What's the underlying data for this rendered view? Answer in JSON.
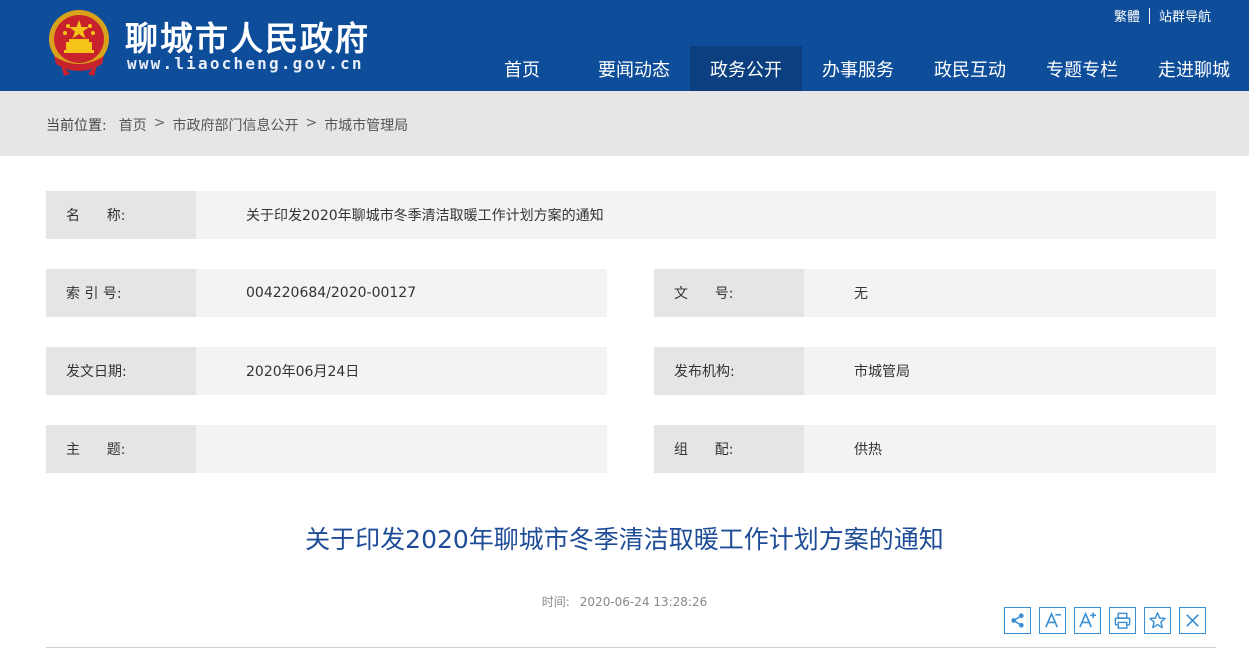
{
  "header": {
    "site_title": "聊城市人民政府",
    "site_url": "www.liaocheng.gov.cn",
    "top_links": [
      "繁體",
      "站群导航"
    ],
    "nav": [
      {
        "label": "首页",
        "active": false
      },
      {
        "label": "要闻动态",
        "active": false
      },
      {
        "label": "政务公开",
        "active": true
      },
      {
        "label": "办事服务",
        "active": false
      },
      {
        "label": "政民互动",
        "active": false
      },
      {
        "label": "专题专栏",
        "active": false
      },
      {
        "label": "走进聊城",
        "active": false
      }
    ]
  },
  "breadcrumb": {
    "label": "当前位置:",
    "items": [
      "首页",
      "市政府部门信息公开",
      "市城市管理局"
    ],
    "separator": ">"
  },
  "info": {
    "name_label": "名      称:",
    "name_value": "关于印发2020年聊城市冬季清洁取暖工作计划方案的通知",
    "index_label": "索 引 号:",
    "index_value": "004220684/2020-00127",
    "docno_label": "文      号:",
    "docno_value": "无",
    "date_label": "发文日期:",
    "date_value": "2020年06月24日",
    "org_label": "发布机构:",
    "org_value": "市城管局",
    "topic_label": "主      题:",
    "topic_value": "",
    "group_label": "组      配:",
    "group_value": "供热"
  },
  "article": {
    "title": "关于印发2020年聊城市冬季清洁取暖工作计划方案的通知",
    "time_label": "时间:",
    "time_value": "2020-06-24 13:28:26"
  },
  "tools": [
    "share-icon",
    "font-decrease-icon",
    "font-increase-icon",
    "print-icon",
    "favorite-star-icon",
    "close-icon"
  ],
  "colors": {
    "header_bg": "#0e4d9a",
    "nav_active_bg": "#0b3f80",
    "title_color": "#1e4c97",
    "tool_border": "#3b8fd4"
  }
}
